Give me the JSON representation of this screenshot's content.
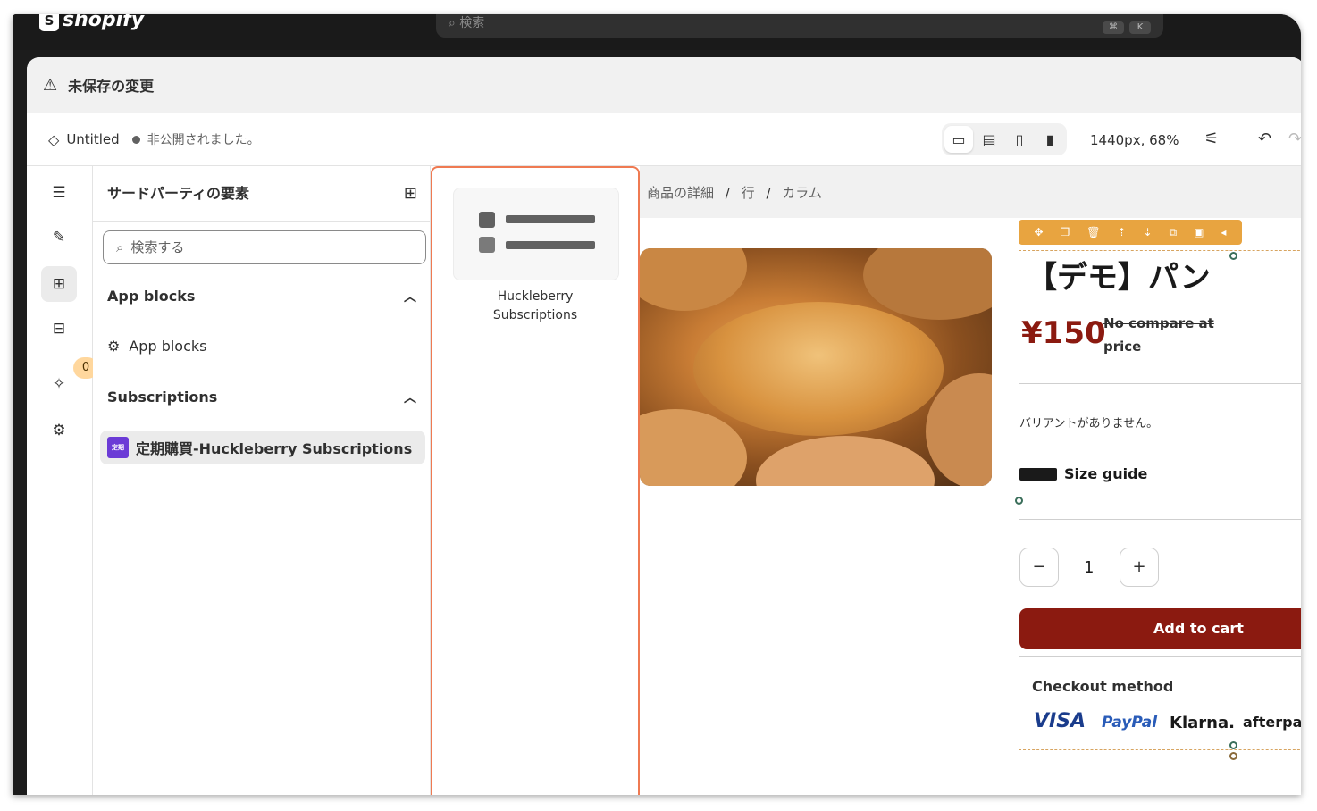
{
  "topbar": {
    "brand": "shopify",
    "search_placeholder": "検索",
    "shortcut_key1": "⌘",
    "shortcut_key2": "K"
  },
  "banner": {
    "text": "未保存の変更"
  },
  "toolbar": {
    "page_name": "Untitled",
    "status": "非公開されました。",
    "viewport": "1440px, 68%"
  },
  "panel": {
    "title": "サードパーティの要素",
    "search_placeholder": "検索する",
    "sections": [
      {
        "label": "App blocks",
        "items": [
          "App blocks"
        ]
      },
      {
        "label": "Subscriptions",
        "items": [
          "定期購買-Huckleberry Subscriptions"
        ]
      }
    ],
    "rail_badge": "0"
  },
  "flyout": {
    "card_label_line1": "Huckleberry",
    "card_label_line2": "Subscriptions"
  },
  "preview": {
    "breadcrumb": [
      "商品の詳細",
      "行",
      "カラム"
    ],
    "product_title": "【デモ】パン",
    "price": "¥150",
    "compare_price_line1": "No compare at",
    "compare_price_line2": "price",
    "no_variants": "バリアントがありません。",
    "size_guide": "Size guide",
    "quantity": "1",
    "qty_minus": "−",
    "qty_plus": "+",
    "add_to_cart": "Add to cart",
    "checkout_title": "Checkout method",
    "payment_methods": [
      "VISA",
      "PayPal",
      "Klarna.",
      "afterpay"
    ]
  },
  "colors": {
    "accent_orange": "#ef7a52",
    "brand_red": "#8b1a10",
    "edit_bar": "#e8a440"
  }
}
